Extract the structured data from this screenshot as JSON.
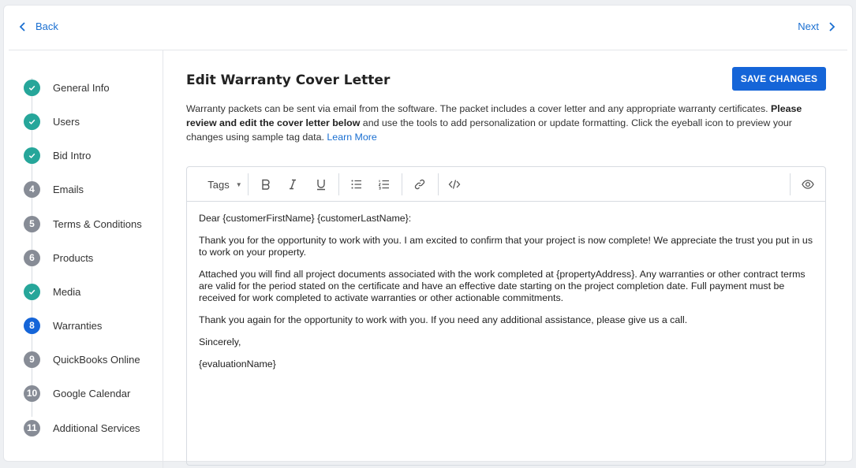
{
  "nav": {
    "back_label": "Back",
    "next_label": "Next"
  },
  "steps": [
    {
      "num": "",
      "label": "General Info",
      "state": "done"
    },
    {
      "num": "",
      "label": "Users",
      "state": "done"
    },
    {
      "num": "",
      "label": "Bid Intro",
      "state": "done"
    },
    {
      "num": "4",
      "label": "Emails",
      "state": "todo"
    },
    {
      "num": "5",
      "label": "Terms & Conditions",
      "state": "todo"
    },
    {
      "num": "6",
      "label": "Products",
      "state": "todo"
    },
    {
      "num": "",
      "label": "Media",
      "state": "done"
    },
    {
      "num": "8",
      "label": "Warranties",
      "state": "active"
    },
    {
      "num": "9",
      "label": "QuickBooks Online",
      "state": "todo"
    },
    {
      "num": "10",
      "label": "Google Calendar",
      "state": "todo"
    },
    {
      "num": "11",
      "label": "Additional Services",
      "state": "todo"
    }
  ],
  "main": {
    "title": "Edit Warranty Cover Letter",
    "save_label": "SAVE CHANGES",
    "desc_part1": "Warranty packets can be sent via email from the software. The packet includes a cover letter and any appropriate warranty certificates. ",
    "desc_bold": "Please review and edit the cover letter below",
    "desc_part2": " and use the tools to add personalization or update formatting. Click the eyeball icon to preview your changes using sample tag data. ",
    "desc_link": "Learn More"
  },
  "editor": {
    "tags_label": "Tags",
    "paragraphs": [
      "Dear {customerFirstName} {customerLastName}:",
      "Thank you for the opportunity to work with you. I am excited to confirm that your project is now complete! We appreciate the trust you put in us to work on your property.",
      "Attached you will find all project documents associated with the work completed at {propertyAddress}. Any warranties or other contract terms are valid for the period stated on the certificate and have an effective date starting on the project completion date. Full payment must be received for work completed to activate warranties or other actionable commitments.",
      "Thank you again for the opportunity to work with you. If you need any additional assistance, please give us a call.",
      "Sincerely,",
      "{evaluationName}"
    ]
  },
  "colors": {
    "accent": "#1565d8",
    "done": "#26a69a",
    "todo": "#878c96",
    "link": "#1a6fd1"
  },
  "icons": [
    "chevron-left-icon",
    "chevron-right-icon",
    "check-icon",
    "bold-icon",
    "italic-icon",
    "underline-icon",
    "bullet-list-icon",
    "numbered-list-icon",
    "link-icon",
    "code-icon",
    "eye-icon"
  ]
}
